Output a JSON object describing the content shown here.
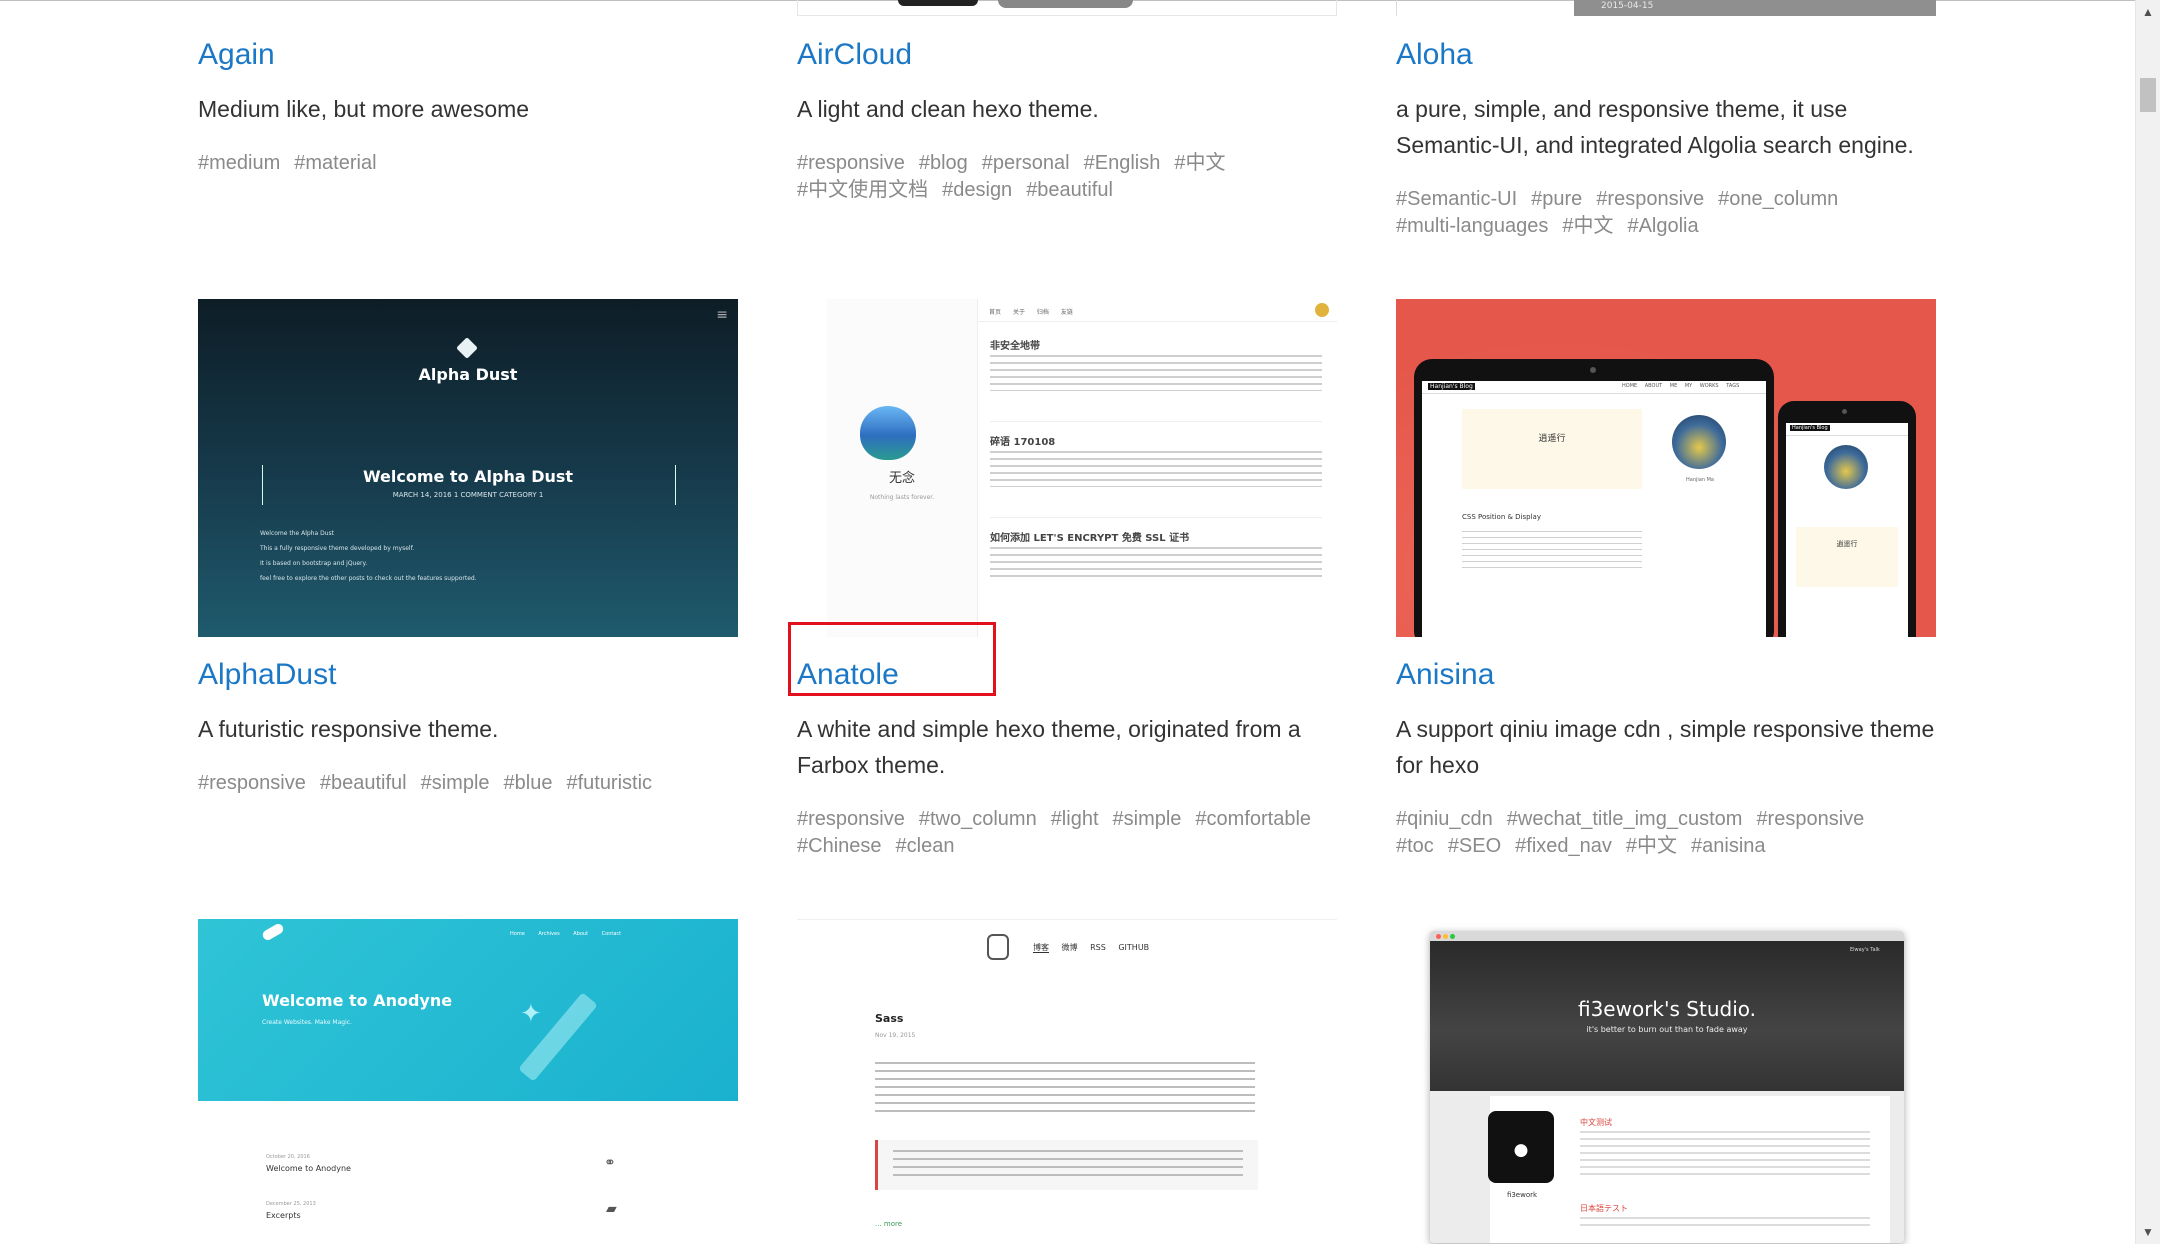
{
  "themes": [
    {
      "title": "Again",
      "desc": "Medium like, but more awesome",
      "tags": [
        "#medium",
        "#material"
      ]
    },
    {
      "title": "AirCloud",
      "desc": "A light and clean hexo theme.",
      "tags": [
        "#responsive",
        "#blog",
        "#personal",
        "#English",
        "#中文",
        "#中文使用文档",
        "#design",
        "#beautiful"
      ]
    },
    {
      "title": "Aloha",
      "desc": "a pure, simple, and responsive theme, it use Semantic-UI, and integrated Algolia search engine.",
      "tags": [
        "#Semantic-UI",
        "#pure",
        "#responsive",
        "#one_column",
        "#multi-languages",
        "#中文",
        "#Algolia"
      ]
    },
    {
      "title": "AlphaDust",
      "desc": "A futuristic responsive theme.",
      "tags": [
        "#responsive",
        "#beautiful",
        "#simple",
        "#blue",
        "#futuristic"
      ]
    },
    {
      "title": "Anatole",
      "desc": "A white and simple hexo theme, originated from a Farbox theme.",
      "tags": [
        "#responsive",
        "#two_column",
        "#light",
        "#simple",
        "#comfortable",
        "#Chinese",
        "#clean"
      ]
    },
    {
      "title": "Anisina",
      "desc": "A support qiniu image cdn , simple responsive theme for hexo",
      "tags": [
        "#qiniu_cdn",
        "#wechat_title_img_custom",
        "#responsive",
        "#toc",
        "#SEO",
        "#fixed_nav",
        "#中文",
        "#anisina"
      ]
    }
  ],
  "previews": {
    "aloha_date": "2015-04-15",
    "alphadust": {
      "logo": "Alpha Dust",
      "welcome": "Welcome to Alpha Dust",
      "meta": "MARCH 14, 2016   1 COMMENT   CATEGORY 1",
      "lines": [
        "Welcome the Alpha Dust",
        "This a fully responsive theme developed by myself.",
        "It is based on bootstrap and jQuery.",
        "feel free to explore the other posts to check out the features supported."
      ]
    },
    "anatole": {
      "nav": [
        "首页",
        "关于",
        "归档",
        "友链"
      ],
      "brand": "无念",
      "sub": "Nothing lasts forever.",
      "posts": [
        "非安全地带",
        "碎语 170108",
        "如何添加 LET'S ENCRYPT 免费 SSL 证书"
      ]
    },
    "anisina": {
      "blog": "Hanjian's Blog",
      "nav": [
        "HOME",
        "ABOUT ME",
        "MY WORKS",
        "TAGS"
      ],
      "poem": "逍遥行",
      "post": "CSS Position & Display",
      "name": "Hanjian Ma"
    },
    "anodyne": {
      "nav": [
        "Home",
        "Archives",
        "About",
        "Contact"
      ],
      "welcome": "Welcome to Anodyne",
      "sub": "Create Websites. Make Magic.",
      "post1_date": "October 20, 2016",
      "post1": "Welcome to Anodyne",
      "post2_date": "December 25, 2013",
      "post2": "Excerpts"
    },
    "apollo": {
      "nav": [
        "博客",
        "微博",
        "RSS",
        "GITHUB"
      ],
      "post": "Sass",
      "date": "Nov 19, 2015",
      "more": "... more"
    },
    "studio": {
      "title": "fi3ework's Studio.",
      "sub": "it's better to burn out than to fade away",
      "brand": "Elway's Talk",
      "h1": "中文测试",
      "h2": "日本語テスト",
      "name": "fi3ework"
    }
  }
}
